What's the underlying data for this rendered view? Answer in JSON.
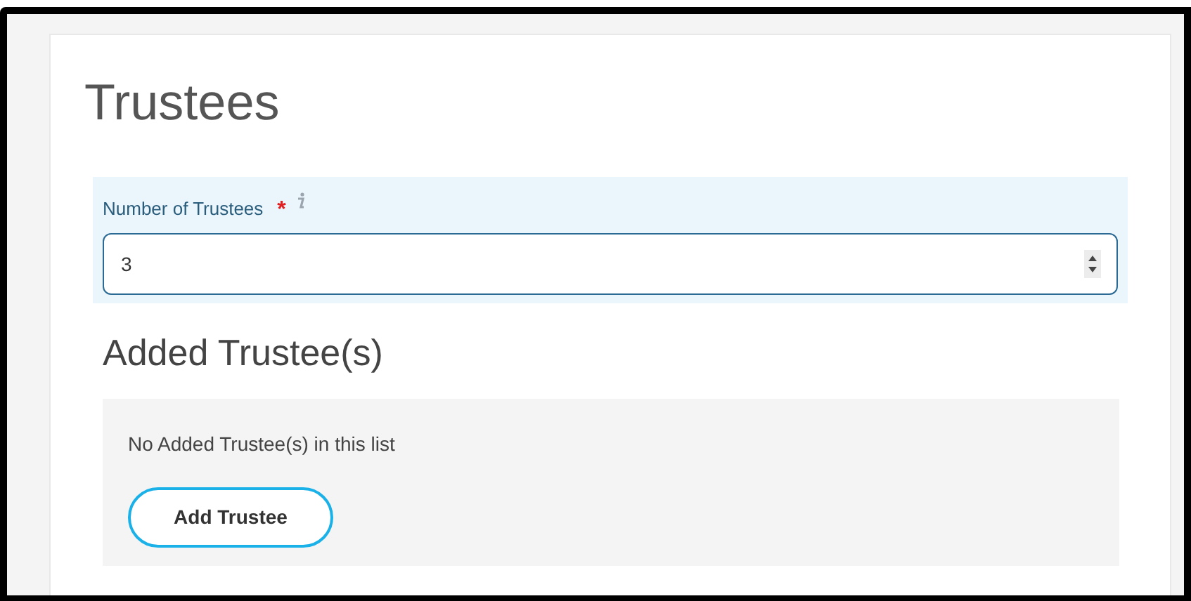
{
  "title": "Trustees",
  "field": {
    "label": "Number of Trustees",
    "required_mark": "*",
    "value": "3"
  },
  "section": {
    "title": "Added Trustee(s)",
    "empty_message": "No Added Trustee(s) in this list",
    "button": "Add Trustee"
  }
}
